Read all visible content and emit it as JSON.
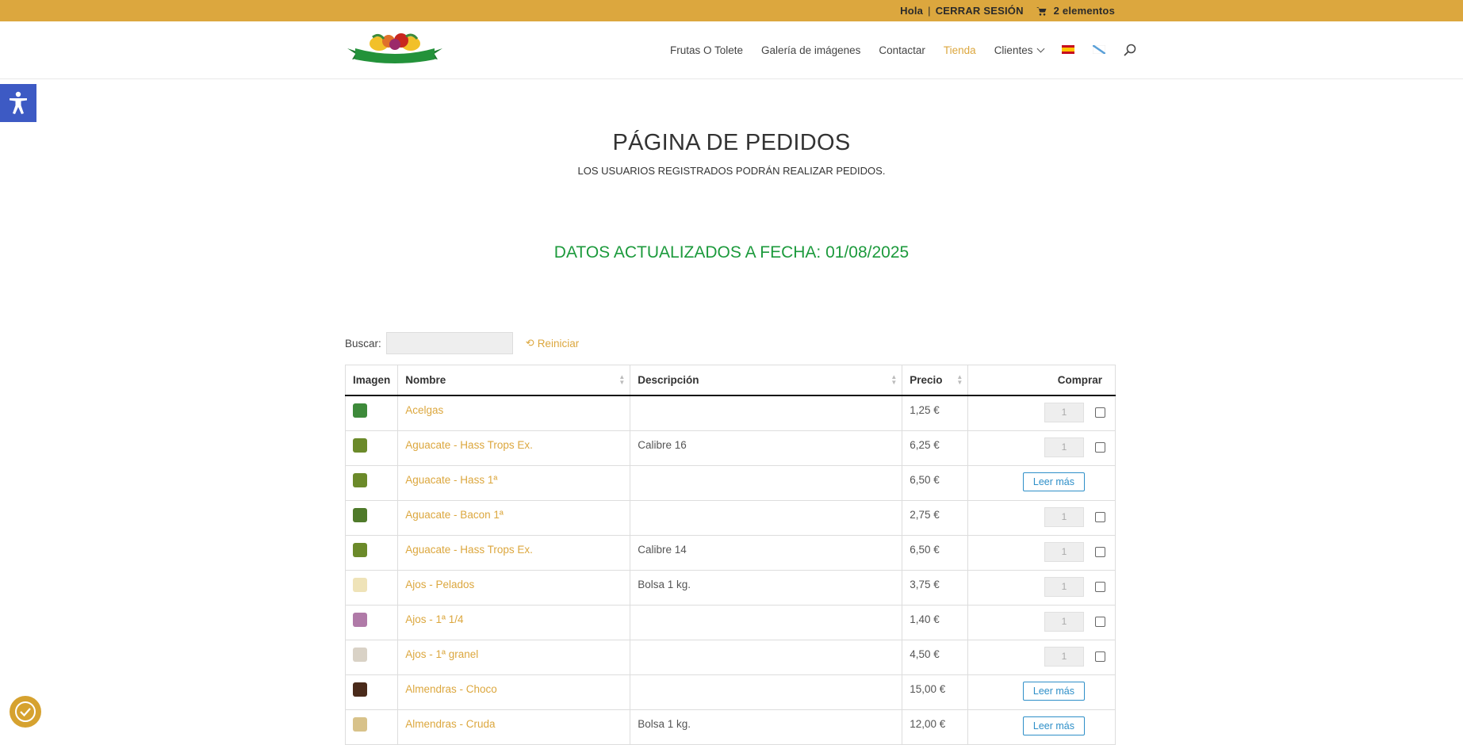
{
  "topbar": {
    "greeting": "Hola",
    "logout": "CERRAR SESIÓN",
    "cart_count": "2 elementos"
  },
  "brand": {
    "logo_text": "Frutas O Tolete"
  },
  "nav": {
    "items": [
      {
        "label": "Frutas O Tolete",
        "active": false
      },
      {
        "label": "Galería de imágenes",
        "active": false
      },
      {
        "label": "Contactar",
        "active": false
      },
      {
        "label": "Tienda",
        "active": true
      },
      {
        "label": "Clientes",
        "active": false
      }
    ]
  },
  "page": {
    "title": "PÁGINA DE PEDIDOS",
    "subtitle": "LOS USUARIOS REGISTRADOS PODRÁN REALIZAR PEDIDOS.",
    "updated": "DATOS ACTUALIZADOS A FECHA: 01/08/2025"
  },
  "search": {
    "label": "Buscar:",
    "value": "",
    "reset_label": "Reiniciar"
  },
  "table": {
    "headers": {
      "image": "Imagen",
      "name": "Nombre",
      "description": "Descripción",
      "price": "Precio",
      "buy": "Comprar"
    },
    "rows": [
      {
        "name": "Acelgas",
        "description": "",
        "price": "1,25 €",
        "action": "qty",
        "qty": "1",
        "thumb": "#3d8a3a"
      },
      {
        "name": "Aguacate - Hass Trops Ex.",
        "description": "Calibre 16",
        "price": "6,25 €",
        "action": "qty",
        "qty": "1",
        "thumb": "#6b8a2a"
      },
      {
        "name": "Aguacate - Hass 1ª",
        "description": "",
        "price": "6,50 €",
        "action": "more",
        "more_label": "Leer más",
        "thumb": "#6b8a2a"
      },
      {
        "name": "Aguacate - Bacon 1ª",
        "description": "",
        "price": "2,75 €",
        "action": "qty",
        "qty": "1",
        "thumb": "#4f7a2a"
      },
      {
        "name": "Aguacate - Hass Trops Ex.",
        "description": "Calibre 14",
        "price": "6,50 €",
        "action": "qty",
        "qty": "1",
        "thumb": "#6b8a2a"
      },
      {
        "name": "Ajos - Pelados",
        "description": "Bolsa 1 kg.",
        "price": "3,75 €",
        "action": "qty",
        "qty": "1",
        "thumb": "#efe3b8"
      },
      {
        "name": "Ajos - 1ª 1/4",
        "description": "",
        "price": "1,40 €",
        "action": "qty",
        "qty": "1",
        "thumb": "#b07aa8"
      },
      {
        "name": "Ajos - 1ª granel",
        "description": "",
        "price": "4,50 €",
        "action": "qty",
        "qty": "1",
        "thumb": "#d9d2c6"
      },
      {
        "name": "Almendras - Choco",
        "description": "",
        "price": "15,00 €",
        "action": "more",
        "more_label": "Leer más",
        "thumb": "#4a2a1a"
      },
      {
        "name": "Almendras - Cruda",
        "description": "Bolsa 1 kg.",
        "price": "12,00 €",
        "action": "more",
        "more_label": "Leer más",
        "thumb": "#d8c28a"
      }
    ]
  },
  "colors": {
    "accent": "#dca73e",
    "success": "#1c9a3c",
    "accessibility": "#3d5ac4",
    "link_blue": "#2e8fc8"
  }
}
